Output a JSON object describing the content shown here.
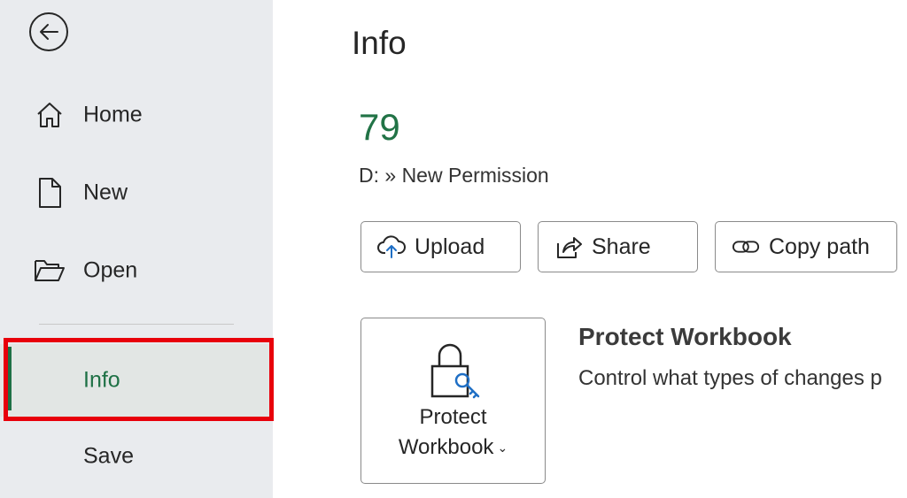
{
  "sidebar": {
    "back_icon": "back-arrow-icon",
    "items": [
      {
        "label": "Home",
        "icon": "home-icon"
      },
      {
        "label": "New",
        "icon": "new-file-icon"
      },
      {
        "label": "Open",
        "icon": "folder-open-icon"
      },
      {
        "label": "Info",
        "icon": "",
        "active": true
      },
      {
        "label": "Save",
        "icon": ""
      }
    ]
  },
  "main": {
    "title": "Info",
    "file_name": "79",
    "file_path": "D: » New Permission",
    "actions": [
      {
        "label": "Upload",
        "icon": "cloud-upload-icon"
      },
      {
        "label": "Share",
        "icon": "share-icon"
      },
      {
        "label": "Copy path",
        "icon": "link-icon"
      }
    ],
    "protect": {
      "tile_line1": "Protect",
      "tile_line2": "Workbook",
      "tile_icon": "lock-key-icon",
      "heading": "Protect Workbook",
      "description": "Control what types of changes p"
    }
  },
  "colors": {
    "accent_green": "#217346",
    "highlight_red": "#e8000b",
    "sidebar_bg": "#e9ebee"
  }
}
